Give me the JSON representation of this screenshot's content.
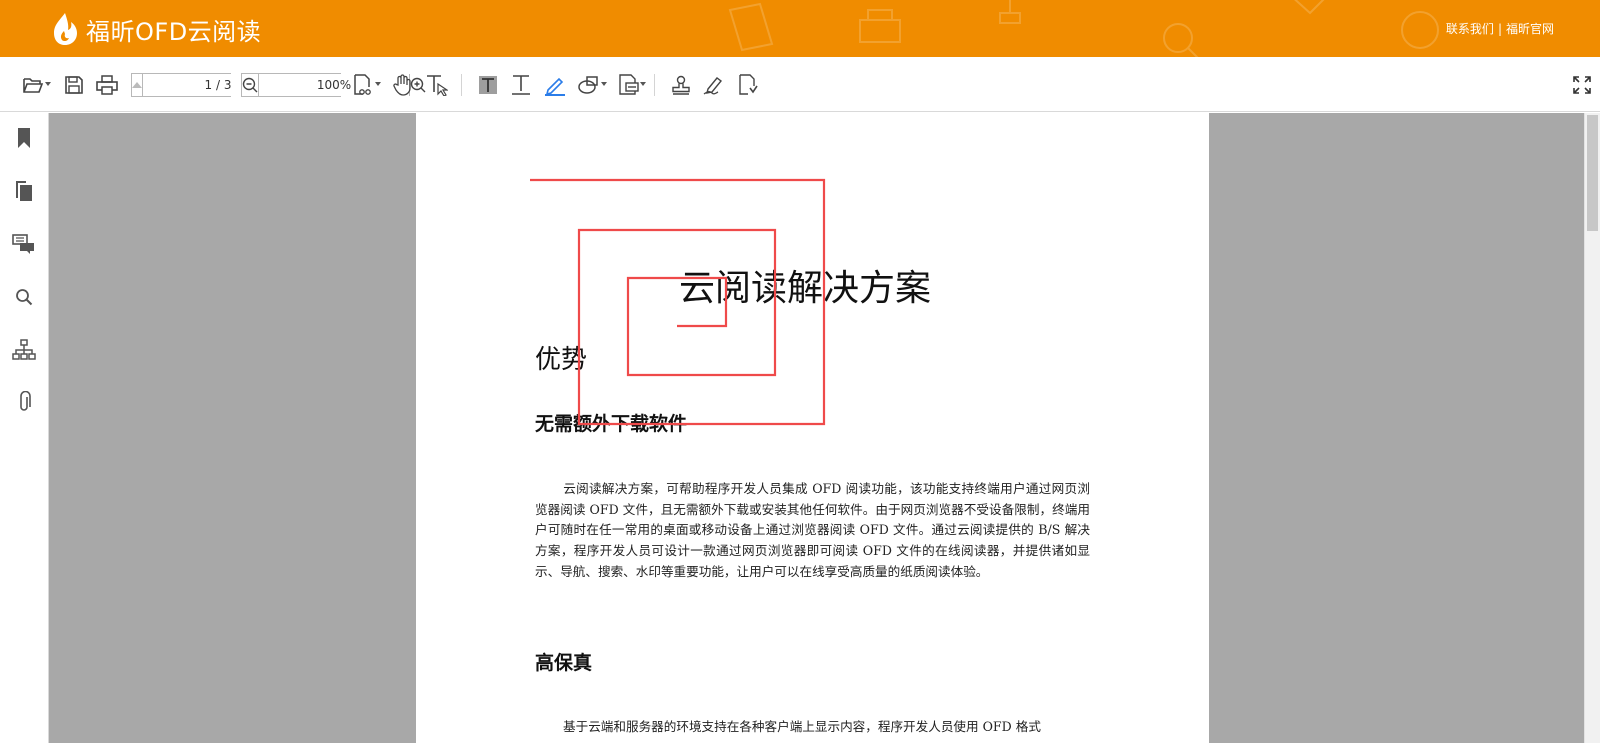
{
  "header": {
    "brand_name": "福昕OFD云阅读",
    "links": {
      "contact": "联系我们",
      "separator": "|",
      "foxit": "福昕官网"
    }
  },
  "toolbar": {
    "page_input": "1 / 3",
    "zoom_input": "100%"
  },
  "document": {
    "title": "云阅读解决方案",
    "heading_advantages": "优势",
    "section1": {
      "heading": "无需额外下载软件",
      "paragraph": "云阅读解决方案，可帮助程序开发人员集成 OFD 阅读功能，该功能支持终端用户通过网页浏览器阅读 OFD 文件，且无需额外下载或安装其他任何软件。由于网页浏览器不受设备限制，终端用户可随时在任一常用的桌面或移动设备上通过浏览器阅读 OFD 文件。通过云阅读提供的 B/S 解决方案，程序开发人员可设计一款通过网页浏览器即可阅读 OFD 文件的在线阅读器，并提供诸如显示、导航、搜索、水印等重要功能，让用户可以在线享受高质量的纸质阅读体验。"
    },
    "section2": {
      "heading": "高保真",
      "paragraph": "基于云端和服务器的环境支持在各种客户端上显示内容，程序开发人员使用 OFD 格式"
    }
  },
  "colors": {
    "header_bg": "#f08c00",
    "viewer_bg": "#a8a8a8",
    "ink_stroke": "#ef4a4a",
    "highlight_blue": "#2b7de9"
  }
}
